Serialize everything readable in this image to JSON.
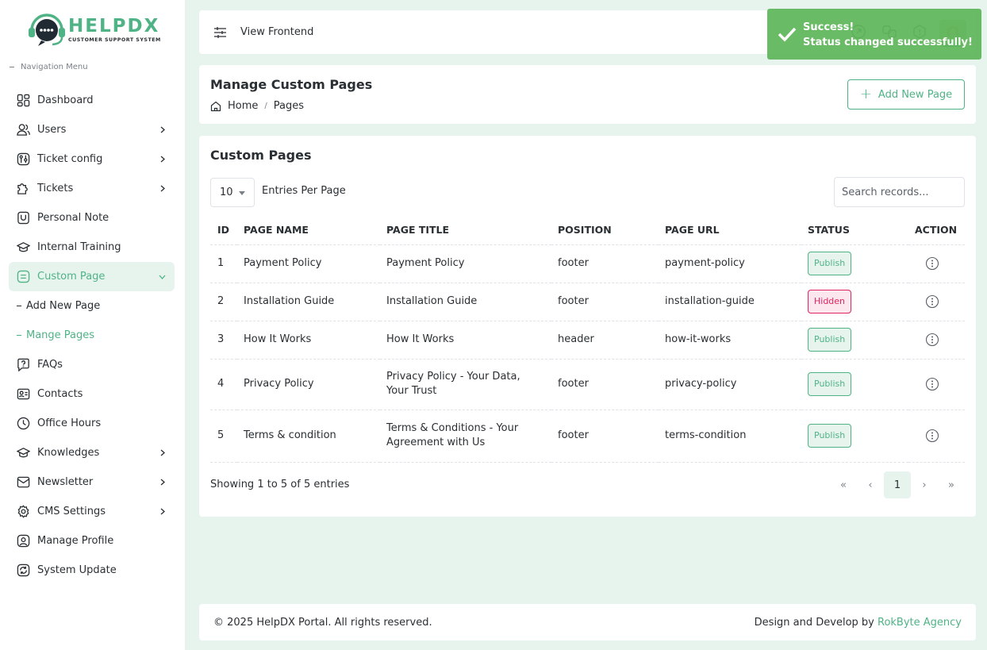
{
  "brand": {
    "name": "HELPDX",
    "tagline": "CUSTOMER SUPPORT SYSTEM",
    "accent": "#4fb386"
  },
  "sidebar": {
    "heading": "Navigation Menu",
    "items": [
      {
        "label": "Dashboard",
        "icon": "dashboard-icon"
      },
      {
        "label": "Users",
        "icon": "users-icon"
      },
      {
        "label": "Ticket config",
        "icon": "ticket-config-icon"
      },
      {
        "label": "Tickets",
        "icon": "tickets-icon"
      },
      {
        "label": "Personal Note",
        "icon": "note-icon"
      },
      {
        "label": "Internal Training",
        "icon": "training-icon"
      },
      {
        "label": "Custom Page",
        "icon": "custom-page-icon",
        "active": true
      },
      {
        "label": "Add New Page"
      },
      {
        "label": "Mange Pages",
        "active": true
      },
      {
        "label": "FAQs",
        "icon": "faq-icon"
      },
      {
        "label": "Contacts",
        "icon": "contacts-icon"
      },
      {
        "label": "Office Hours",
        "icon": "clock-icon"
      },
      {
        "label": "Knowledges",
        "icon": "knowledge-icon"
      },
      {
        "label": "Newsletter",
        "icon": "newsletter-icon"
      },
      {
        "label": "CMS Settings",
        "icon": "gear-icon"
      },
      {
        "label": "Manage Profile",
        "icon": "profile-icon"
      },
      {
        "label": "System Update",
        "icon": "update-icon"
      }
    ]
  },
  "topbar": {
    "view_frontend": "View Frontend"
  },
  "toast": {
    "title": "Success!",
    "message": "Status changed successfully!"
  },
  "header": {
    "title": "Manage Custom Pages",
    "breadcrumb_home": "Home",
    "breadcrumb_current": "Pages",
    "add_button": "Add New Page"
  },
  "table_card": {
    "title": "Custom Pages",
    "per_page": "10",
    "per_page_label": "Entries Per Page",
    "search_placeholder": "Search records...",
    "columns": [
      "ID",
      "PAGE NAME",
      "PAGE TITLE",
      "POSITION",
      "PAGE URL",
      "STATUS",
      "ACTION"
    ],
    "rows": [
      {
        "id": "1",
        "name": "Payment Policy",
        "title": "Payment Policy",
        "position": "footer",
        "url": "payment-policy",
        "status": "Publish"
      },
      {
        "id": "2",
        "name": "Installation Guide",
        "title": "Installation Guide",
        "position": "footer",
        "url": "installation-guide",
        "status": "Hidden"
      },
      {
        "id": "3",
        "name": "How It Works",
        "title": "How It Works",
        "position": "header",
        "url": "how-it-works",
        "status": "Publish"
      },
      {
        "id": "4",
        "name": "Privacy Policy",
        "title": "Privacy Policy - Your Data, Your Trust",
        "position": "footer",
        "url": "privacy-policy",
        "status": "Publish"
      },
      {
        "id": "5",
        "name": "Terms & condition",
        "title": "Terms & Conditions - Your Agreement with Us",
        "position": "footer",
        "url": "terms-condition",
        "status": "Publish"
      }
    ],
    "showing": "Showing 1 to 5 of 5 entries",
    "pager": {
      "first": "«",
      "prev": "‹",
      "current": "1",
      "next": "›",
      "last": "»"
    }
  },
  "footer": {
    "copyright": "© 2025 HelpDX Portal. All rights reserved.",
    "credit_prefix": "Design and Develop by ",
    "credit_link": "RokByte Agency"
  }
}
